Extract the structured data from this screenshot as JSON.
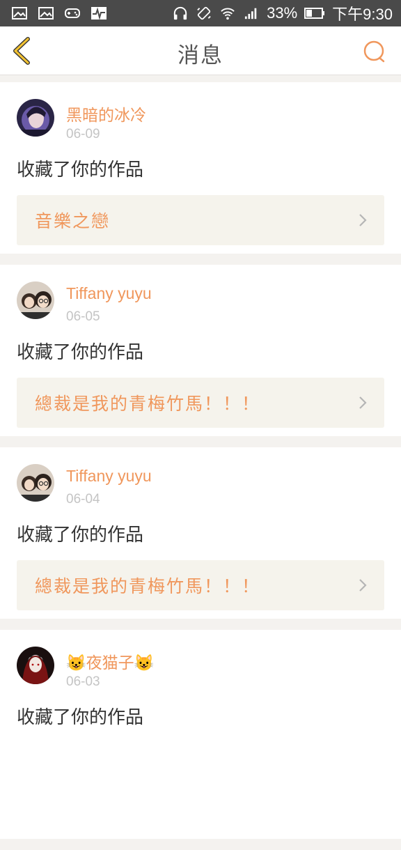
{
  "status_bar": {
    "battery": "33%",
    "time": "下午9:30",
    "icons": [
      "image-icon",
      "image-icon",
      "gamepad-icon",
      "activity-icon",
      "headphones-icon",
      "vibrate-icon",
      "wifi-icon",
      "signal-icon",
      "battery-icon"
    ]
  },
  "header": {
    "title": "消息",
    "back_icon": "chevron-left-icon",
    "search_icon": "search-icon"
  },
  "messages": [
    {
      "user": "黑暗的冰冷",
      "date": "06-09",
      "action": "收藏了你的作品",
      "work": "音樂之戀"
    },
    {
      "user": "Tiffany yuyu",
      "date": "06-05",
      "action": "收藏了你的作品",
      "work": "總裁是我的青梅竹馬！！！"
    },
    {
      "user": "Tiffany yuyu",
      "date": "06-04",
      "action": "收藏了你的作品",
      "work": "總裁是我的青梅竹馬！！！"
    },
    {
      "user": "😺夜猫子😺",
      "date": "06-03",
      "action": "收藏了你的作品",
      "work": ""
    }
  ],
  "colors": {
    "accent": "#f0975c",
    "status_bar": "#4a4a4a",
    "back_arrow": "#f2c232",
    "work_bg": "#f5f3ec"
  }
}
